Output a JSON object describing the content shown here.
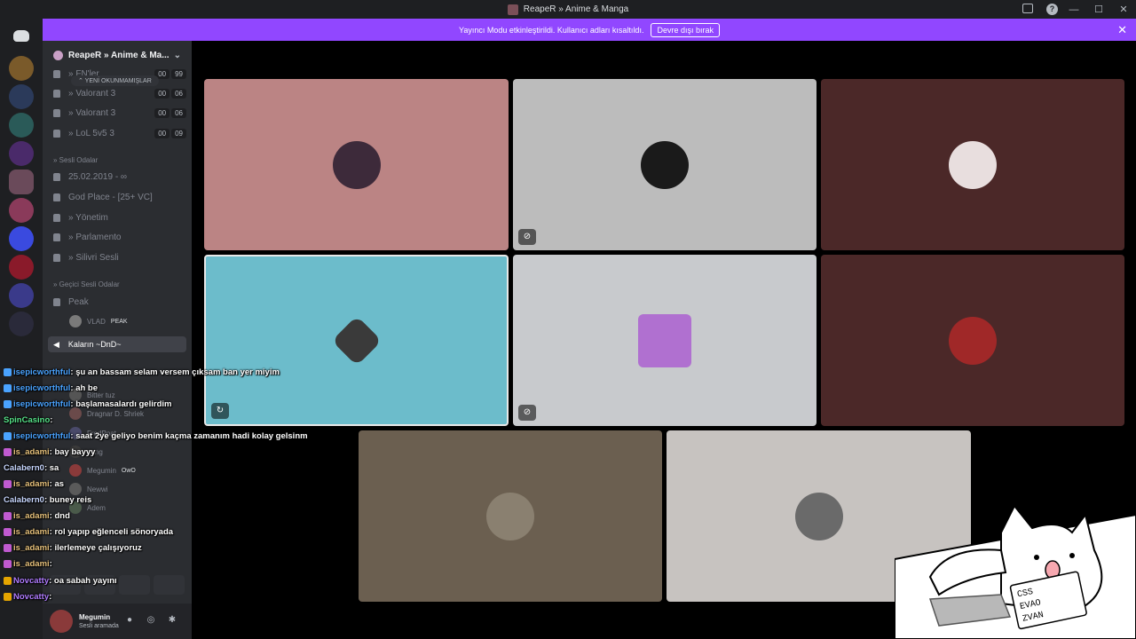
{
  "window": {
    "title": "ReapeR » Anime & Manga",
    "controls": [
      "—",
      "☐",
      "✕"
    ]
  },
  "banner": {
    "text": "Yayıncı Modu etkinleştirildi. Kullanıcı adları kısaltıldı.",
    "button_label": "Devre dışı bırak",
    "close": "✕"
  },
  "guild": {
    "name": "ReapeR » Anime & Ma...",
    "new_unreads": "⌃ YENİ OKUNMAMIŞLAR"
  },
  "channels": [
    {
      "label": "» FN'ler",
      "counts": [
        "00",
        "99"
      ]
    },
    {
      "label": "» Valorant 3",
      "counts": [
        "00",
        "06"
      ]
    },
    {
      "label": "» Valorant 3",
      "counts": [
        "00",
        "06"
      ]
    },
    {
      "label": "» LoL 5v5 3",
      "counts": [
        "00",
        "09"
      ]
    }
  ],
  "voice_category": "» Sesli Odalar",
  "voice_channels": [
    {
      "label": "25.02.2019 - ∞"
    },
    {
      "label": "God Place - [25+ VC]"
    },
    {
      "label": "» Yönetim"
    },
    {
      "label": "» Parlamento"
    },
    {
      "label": "» Silivri Sesli"
    }
  ],
  "temp_category": "» Geçici Sesli Odalar",
  "temp_channel": "Peak",
  "peak_user": {
    "name": "VLAD",
    "tag": "PEAK"
  },
  "active_channel": "Kaların ~DnD~",
  "voice_users": [
    {
      "name": "Bitter tuz"
    },
    {
      "name": "Dragnar D. Shriek"
    },
    {
      "name": "FredPoat"
    },
    {
      "name": "gang"
    },
    {
      "name": "Megumin",
      "tag": "OwO"
    },
    {
      "name": "Newwi"
    },
    {
      "name": "Adem"
    }
  ],
  "user_panel": {
    "name": "Megumin",
    "status": "Sesli aramada"
  },
  "chat": [
    {
      "user": "isepicworthful",
      "text": ": şu an bassam selam versem çıksam ban yer miyim",
      "color": "#4aa3ff"
    },
    {
      "user": "isepicworthful",
      "text": ": ah be",
      "color": "#4aa3ff"
    },
    {
      "user": "isepicworthful",
      "text": ": başlamasalardı gelirdim",
      "color": "#4aa3ff"
    },
    {
      "user": "SpinCasino",
      "text": ":",
      "color": "#57e389"
    },
    {
      "user": "isepicworthful",
      "text": ": saat 2ye geliyo benim kaçma zamanım hadi kolay gelsinm",
      "color": "#4aa3ff"
    },
    {
      "user": "is_adami",
      "text": ": bay bayyy",
      "color": "#e5c07b"
    },
    {
      "user": "Calabern0",
      "text": ": sa",
      "color": "#c8d7ff"
    },
    {
      "user": "is_adami",
      "text": ": as",
      "color": "#e5c07b"
    },
    {
      "user": "Calabern0",
      "text": ": buney reis",
      "color": "#c8d7ff"
    },
    {
      "user": "is_adami",
      "text": ": dnd",
      "color": "#e5c07b"
    },
    {
      "user": "is_adami",
      "text": ": rol yapıp eğlenceli sönoryada",
      "color": "#e5c07b"
    },
    {
      "user": "is_adami",
      "text": ": ilerlemeye çalışıyoruz",
      "color": "#e5c07b"
    },
    {
      "user": "is_adami",
      "text": ":",
      "color": "#e5c07b"
    },
    {
      "user": "Novcatty",
      "text": ": oa sabah yayını",
      "color": "#b07cff"
    },
    {
      "user": "Novcatty",
      "text": ":",
      "color": "#b07cff"
    }
  ],
  "tiles": [
    {
      "bg": "#bb8484",
      "avatar": "#3d2a3a",
      "badge": null
    },
    {
      "bg": "#bcbcbc",
      "avatar": "#1a1a1a",
      "badge": "mic-off"
    },
    {
      "bg": "#4b2828",
      "avatar": "#e8dede",
      "badge": null
    },
    {
      "bg": "#6cbccb",
      "avatar": "#3a3a3a",
      "badge": "video"
    },
    {
      "bg": "#c8cacd",
      "avatar": "#b070d0",
      "badge": "mic-off"
    },
    {
      "bg": "#4b2828",
      "avatar": "#a02828",
      "badge": null
    },
    {
      "bg": "#6b5f50",
      "avatar": "#8a8070",
      "badge": null
    },
    {
      "bg": "#c7c3c0",
      "avatar": "#6a6a6a",
      "badge": null
    }
  ],
  "overlay_keys": [
    "CSS",
    "EVAO",
    "ZVAN"
  ]
}
